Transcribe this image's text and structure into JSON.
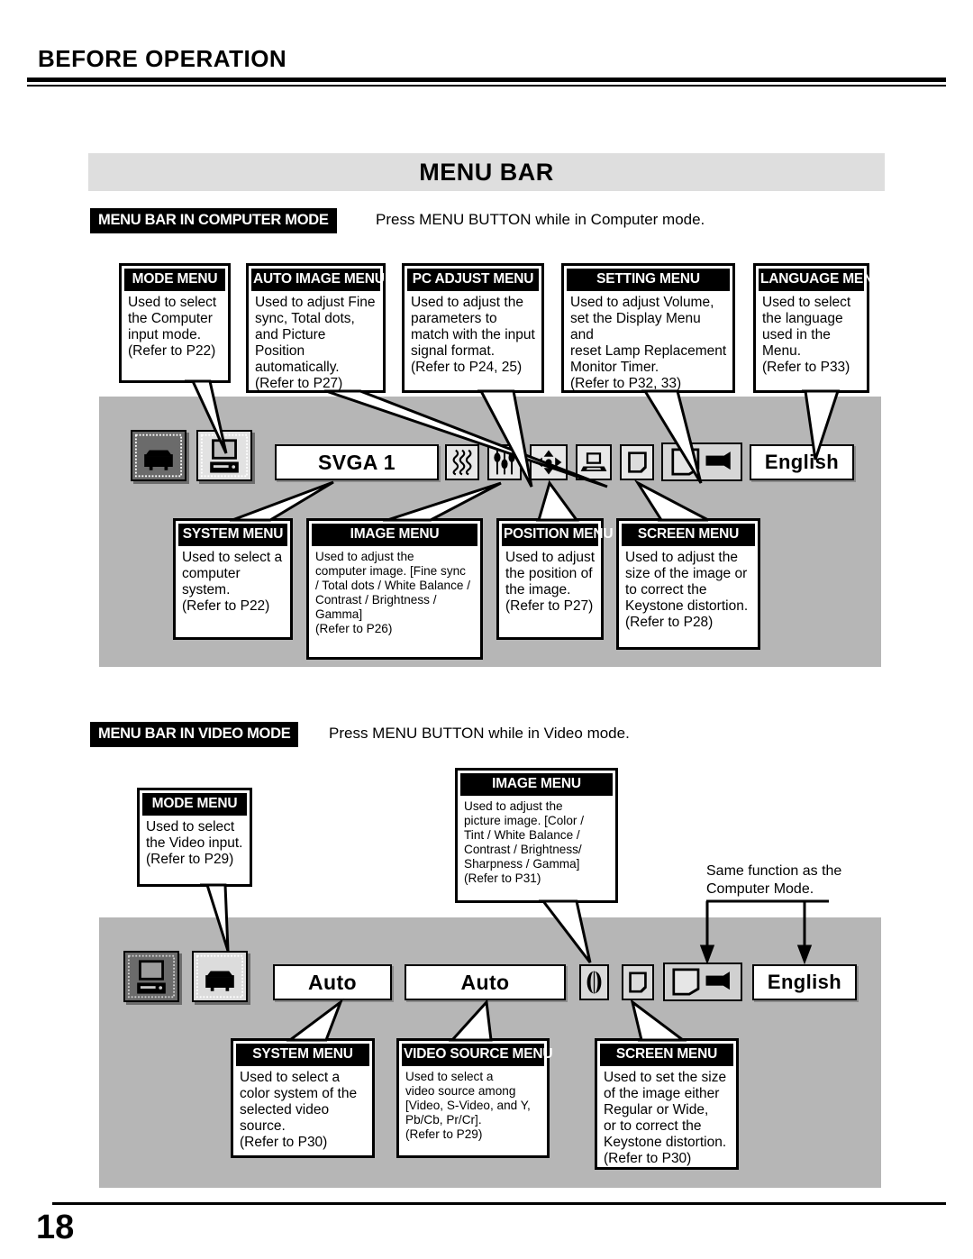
{
  "page": {
    "header_title": "BEFORE OPERATION",
    "page_number": "18"
  },
  "banner": {
    "title": "MENU BAR"
  },
  "computer_section": {
    "tag": "MENU BAR IN COMPUTER MODE",
    "note": "Press MENU BUTTON while in Computer mode.",
    "osd": {
      "source_icon": "projector-icon",
      "mode_icon": "computer-monitor-icon",
      "system_value": "SVGA 1",
      "image_icon": "wave-pattern-icon",
      "pc_adjust_icon": "sliders-icon",
      "position_icon": "four-arrows-icon",
      "auto_image_icon": "laptop-icon",
      "screen_icon": "screen-page-icon",
      "setting_icon": "setting-projector-icon",
      "language_value": "English"
    },
    "top_callouts": [
      {
        "title": "MODE MENU",
        "body": "Used to select\nthe Computer\ninput mode.\n(Refer to P22)"
      },
      {
        "title": "AUTO IMAGE MENU",
        "body": "Used to adjust Fine\nsync, Total dots,\nand Picture Position\nautomatically.\n(Refer to P27)"
      },
      {
        "title": "PC ADJUST MENU",
        "body": "Used to adjust the\nparameters to\nmatch with the input\nsignal format.\n(Refer to P24, 25)"
      },
      {
        "title": "SETTING MENU",
        "body": "Used to adjust Volume,\nset the Display Menu and\nreset Lamp Replacement\nMonitor Timer.\n(Refer to P32, 33)"
      },
      {
        "title": "LANGUAGE MENU",
        "body": "Used to select\nthe language\nused in the\nMenu.\n(Refer to P33)"
      }
    ],
    "bottom_callouts": [
      {
        "title": "SYSTEM MENU",
        "body": "Used to select a\ncomputer\nsystem.\n(Refer to P22)"
      },
      {
        "title": "IMAGE MENU",
        "body": "Used to adjust the\ncomputer image. [Fine sync\n/ Total dots / White Balance /\nContrast / Brightness /\nGamma]\n(Refer to P26)"
      },
      {
        "title": "POSITION MENU",
        "body": "Used to adjust\nthe position of\nthe image.\n(Refer to P27)"
      },
      {
        "title": "SCREEN MENU",
        "body": "Used to adjust the\nsize of the image or\nto correct the\nKeystone distortion.\n(Refer to P28)"
      }
    ]
  },
  "video_section": {
    "tag": "MENU BAR IN VIDEO MODE",
    "note": "Press MENU BUTTON while in Video mode.",
    "same_function_note": "Same function as the\nComputer Mode.",
    "osd": {
      "mode_icon": "computer-monitor-icon",
      "source_icon": "projector-icon",
      "system_value": "Auto",
      "video_source_value": "Auto",
      "image_icon": "sphere-pattern-icon",
      "screen_icon": "screen-page-icon",
      "setting_icon": "setting-projector-icon",
      "language_value": "English"
    },
    "top_callouts": [
      {
        "title": "MODE MENU",
        "body": "Used to select\nthe Video input.\n(Refer to P29)"
      },
      {
        "title": "IMAGE MENU",
        "body": "Used to adjust the\npicture image.  [Color /\nTint / White Balance /\nContrast / Brightness/\nSharpness / Gamma]\n(Refer to P31)"
      }
    ],
    "bottom_callouts": [
      {
        "title": "SYSTEM MENU",
        "body": "Used to select a\ncolor system of the\nselected video\nsource.\n(Refer to P30)"
      },
      {
        "title": "VIDEO SOURCE MENU",
        "body": "Used to select a\nvideo source among\n[Video, S-Video, and Y,\nPb/Cb, Pr/Cr].\n(Refer to P29)"
      },
      {
        "title": "SCREEN MENU",
        "body": "Used to set the size\nof the image either\nRegular or  Wide,\nor to correct the\nKeystone distortion.\n(Refer to P30)"
      }
    ]
  },
  "colors": {
    "panel_gray": "#b6b6b6",
    "banner_gray": "#dedede",
    "title_black": "#000000"
  }
}
